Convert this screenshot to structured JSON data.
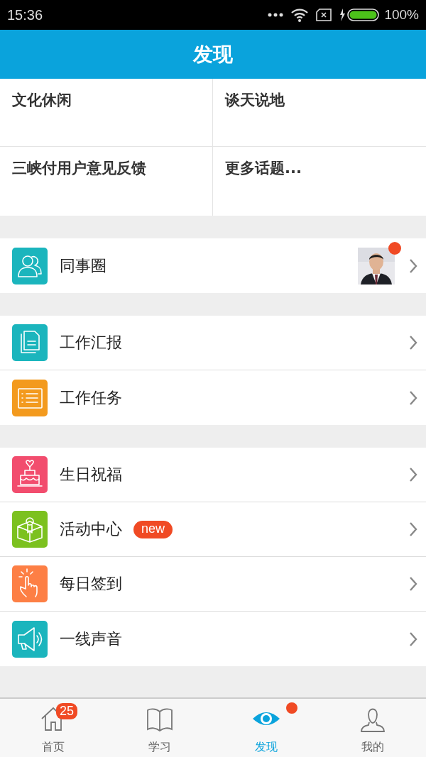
{
  "status_bar": {
    "time": "15:36",
    "battery": "100%"
  },
  "header": {
    "title": "发现"
  },
  "topics": [
    {
      "label": "文化休闲"
    },
    {
      "label": "谈天说地"
    },
    {
      "label": "三峡付用户意见反馈"
    },
    {
      "label": "更多话题..."
    }
  ],
  "groups": [
    {
      "items": [
        {
          "label": "同事圈",
          "color": "#1bb5bd",
          "dot": true
        }
      ]
    },
    {
      "items": [
        {
          "label": "工作汇报",
          "color": "#1bb5bd",
          "dot": false
        },
        {
          "label": "工作任务",
          "color": "#f39a1e",
          "dot": false
        }
      ]
    },
    {
      "items": [
        {
          "label": "生日祝福",
          "color": "#f24d6e",
          "dot": false
        },
        {
          "label": "活动中心",
          "color": "#7cc11f",
          "badge": "new",
          "dot": false
        },
        {
          "label": "每日签到",
          "color": "#fd7f45",
          "dot": false
        },
        {
          "label": "一线声音",
          "color": "#1bb5bd",
          "dot": false
        }
      ]
    }
  ],
  "tabs": [
    {
      "label": "首页",
      "selected": false,
      "badge": "25",
      "dot": false
    },
    {
      "label": "学习",
      "selected": false,
      "dot": false
    },
    {
      "label": "发现",
      "selected": true,
      "dot": true
    },
    {
      "label": "我的",
      "selected": false,
      "dot": false
    }
  ]
}
